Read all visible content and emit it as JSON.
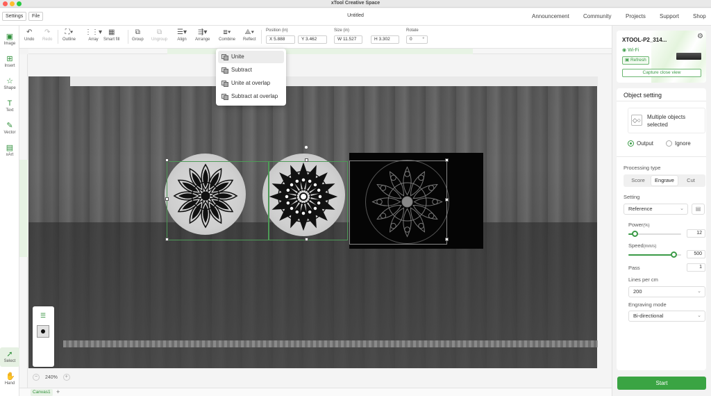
{
  "window": {
    "title": "xTool Creative Space"
  },
  "menubar": {
    "settings_label": "Settings",
    "file_label": "File",
    "document_title": "Untitled",
    "nav_links": [
      "Announcement",
      "Community",
      "Projects",
      "Support",
      "Shop"
    ]
  },
  "left_toolbar": {
    "items": [
      {
        "label": "Image",
        "icon": "image-icon"
      },
      {
        "label": "Insert",
        "icon": "insert-icon"
      },
      {
        "label": "Shape",
        "icon": "shape-icon"
      },
      {
        "label": "Text",
        "icon": "text-icon"
      },
      {
        "label": "Vector",
        "icon": "pen-icon"
      },
      {
        "label": "xArt",
        "icon": "xart-icon"
      }
    ],
    "bottom_items": [
      {
        "label": "Select",
        "icon": "cursor-icon",
        "active": true
      },
      {
        "label": "Hand",
        "icon": "hand-icon"
      }
    ]
  },
  "toolbar": {
    "undo": "Undo",
    "redo": "Redo",
    "outline": "Outline",
    "array": "Array",
    "smart_fill": "Smart fill",
    "group": "Group",
    "ungroup": "Ungroup",
    "align": "Align",
    "arrange": "Arrange",
    "combine": "Combine",
    "reflect": "Reflect",
    "position_label": "Position (in)",
    "pos_x": "X 5.888",
    "pos_y": "Y 3.462",
    "size_label": "Size (in)",
    "size_w": "W 11.527",
    "size_h": "H 3.302",
    "rotate_label": "Rotate",
    "rotate_value": "0",
    "rotate_unit": "°"
  },
  "combine_menu": {
    "items": [
      "Unite",
      "Subtract",
      "Unite at overlap",
      "Subtract at overlap"
    ],
    "hovered": "Unite"
  },
  "canvas": {
    "zoom_value": "240%",
    "zoom_minus": "−",
    "zoom_plus": "+",
    "tab_label": "Canvas1",
    "add_tab": "+"
  },
  "device": {
    "name": "XTOOL-P2_314...",
    "connection": "Wi-Fi",
    "refresh_label": "Refresh",
    "capture_label": "Capture close view"
  },
  "object_setting": {
    "title": "Object setting",
    "selection_text": "Multiple objects selected",
    "output_label": "Output",
    "ignore_label": "Ignore",
    "output_selected": "Output",
    "processing_type_label": "Processing type",
    "processing_types": [
      "Score",
      "Engrave",
      "Cut"
    ],
    "processing_selected": "Engrave",
    "setting_label": "Setting",
    "setting_value": "Reference",
    "power_label": "Power",
    "power_unit": "(%)",
    "power_value": "12",
    "power_fraction": 0.12,
    "speed_label": "Speed",
    "speed_unit": "(mm/s)",
    "speed_value": "500",
    "speed_fraction": 0.85,
    "pass_label": "Pass",
    "pass_value": "1",
    "lines_label": "Lines per cm",
    "lines_value": "200",
    "mode_label": "Engraving mode",
    "mode_value": "Bi-directional"
  },
  "actions": {
    "start_label": "Start"
  },
  "colors": {
    "accent": "#3aa443",
    "selection": "#4e9a57"
  }
}
